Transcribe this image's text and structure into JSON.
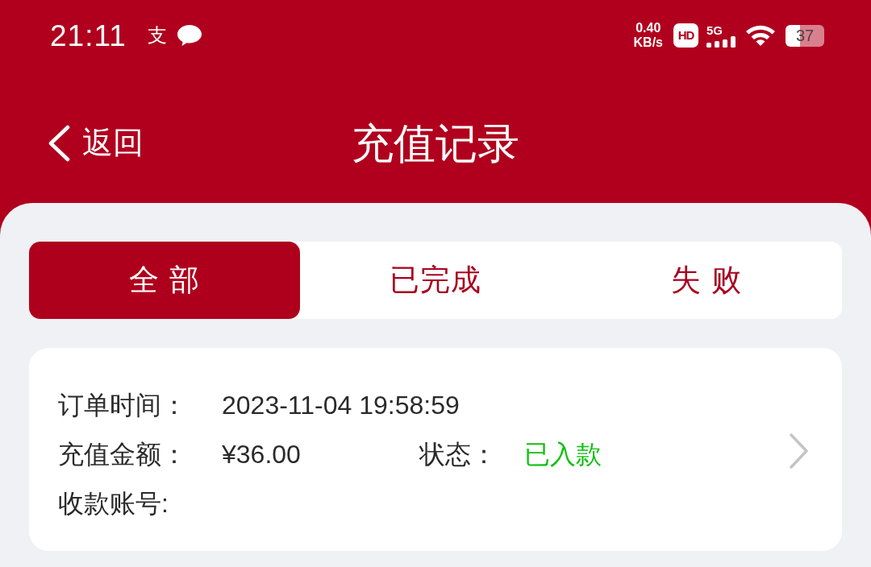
{
  "status_bar": {
    "time": "21:11",
    "notification_glyph": "支",
    "speed": "0.40",
    "speed_unit": "KB/s",
    "hd_badge": "HD",
    "network": "5G",
    "battery": "37"
  },
  "header": {
    "back": "返回",
    "title": "充值记录"
  },
  "tabs": [
    {
      "label": "全 部",
      "selected": true
    },
    {
      "label": "已完成",
      "selected": false
    },
    {
      "label": "失 败",
      "selected": false
    }
  ],
  "records": [
    {
      "order_time_label": "订单时间：",
      "order_time": "2023-11-04 19:58:59",
      "amount_label": "充值金额：",
      "amount": "¥36.00",
      "status_label": "状态：",
      "status": "已入款",
      "account_label": "收款账号:"
    }
  ]
}
